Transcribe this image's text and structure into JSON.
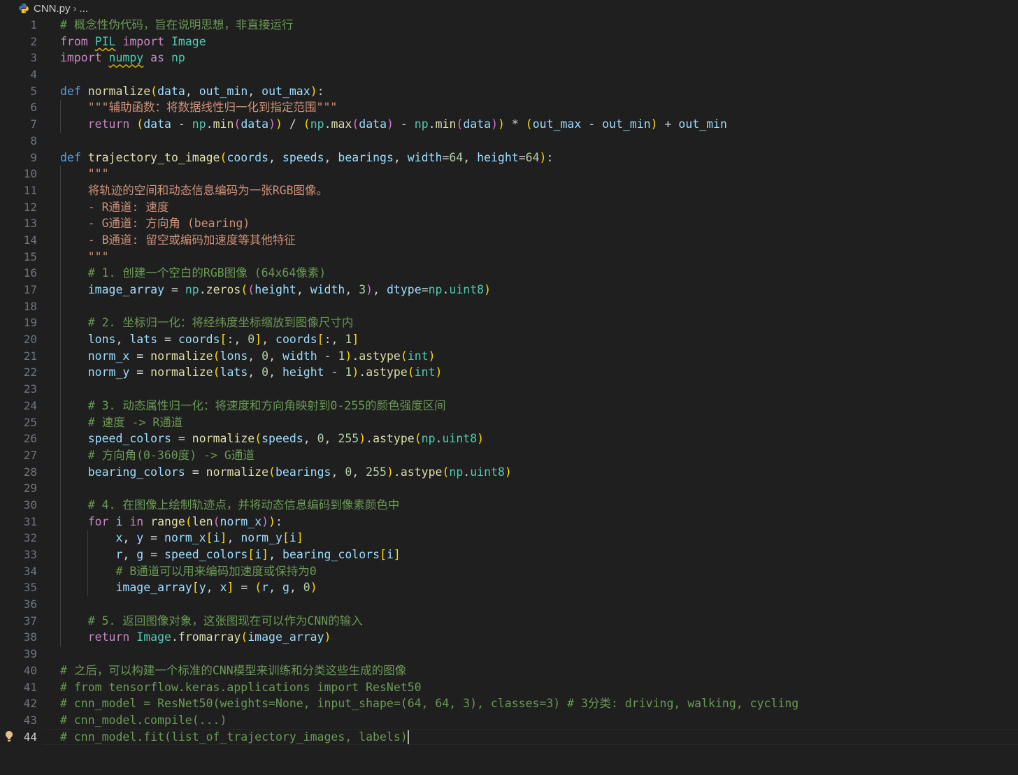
{
  "breadcrumb": {
    "file": "CNN.py",
    "rest": "..."
  },
  "editor": {
    "active_line": 44,
    "lines": [
      [
        [
          "cmt",
          "# 概念性伪代码，旨在说明思想，非直接运行"
        ]
      ],
      [
        [
          "ctl",
          "from"
        ],
        [
          "op",
          " "
        ],
        [
          "cls sq",
          "PIL"
        ],
        [
          "op",
          " "
        ],
        [
          "ctl",
          "import"
        ],
        [
          "op",
          " "
        ],
        [
          "cls",
          "Image"
        ]
      ],
      [
        [
          "ctl",
          "import"
        ],
        [
          "op",
          " "
        ],
        [
          "cls sq",
          "numpy"
        ],
        [
          "op",
          " "
        ],
        [
          "ctl",
          "as"
        ],
        [
          "op",
          " "
        ],
        [
          "cls",
          "np"
        ]
      ],
      [],
      [
        [
          "kw",
          "def"
        ],
        [
          "op",
          " "
        ],
        [
          "fn",
          "normalize"
        ],
        [
          "p1",
          "("
        ],
        [
          "var",
          "data"
        ],
        [
          "op",
          ", "
        ],
        [
          "var",
          "out_min"
        ],
        [
          "op",
          ", "
        ],
        [
          "var",
          "out_max"
        ],
        [
          "p1",
          ")"
        ],
        [
          "op",
          ":"
        ]
      ],
      [
        [
          "op",
          "    "
        ],
        [
          "str",
          "\"\"\"辅助函数：将数据线性归一化到指定范围\"\"\""
        ]
      ],
      [
        [
          "op",
          "    "
        ],
        [
          "ctl",
          "return"
        ],
        [
          "op",
          " "
        ],
        [
          "p1",
          "("
        ],
        [
          "var",
          "data"
        ],
        [
          "op",
          " - "
        ],
        [
          "cls",
          "np"
        ],
        [
          "op",
          "."
        ],
        [
          "fn",
          "min"
        ],
        [
          "p2",
          "("
        ],
        [
          "var",
          "data"
        ],
        [
          "p2",
          ")"
        ],
        [
          "p1",
          ")"
        ],
        [
          "op",
          " / "
        ],
        [
          "p1",
          "("
        ],
        [
          "cls",
          "np"
        ],
        [
          "op",
          "."
        ],
        [
          "fn",
          "max"
        ],
        [
          "p2",
          "("
        ],
        [
          "var",
          "data"
        ],
        [
          "p2",
          ")"
        ],
        [
          "op",
          " - "
        ],
        [
          "cls",
          "np"
        ],
        [
          "op",
          "."
        ],
        [
          "fn",
          "min"
        ],
        [
          "p2",
          "("
        ],
        [
          "var",
          "data"
        ],
        [
          "p2",
          ")"
        ],
        [
          "p1",
          ")"
        ],
        [
          "op",
          " * "
        ],
        [
          "p1",
          "("
        ],
        [
          "var",
          "out_max"
        ],
        [
          "op",
          " - "
        ],
        [
          "var",
          "out_min"
        ],
        [
          "p1",
          ")"
        ],
        [
          "op",
          " + "
        ],
        [
          "var",
          "out_min"
        ]
      ],
      [],
      [
        [
          "kw",
          "def"
        ],
        [
          "op",
          " "
        ],
        [
          "fn",
          "trajectory_to_image"
        ],
        [
          "p1",
          "("
        ],
        [
          "var",
          "coords"
        ],
        [
          "op",
          ", "
        ],
        [
          "var",
          "speeds"
        ],
        [
          "op",
          ", "
        ],
        [
          "var",
          "bearings"
        ],
        [
          "op",
          ", "
        ],
        [
          "var",
          "width"
        ],
        [
          "op",
          "="
        ],
        [
          "num",
          "64"
        ],
        [
          "op",
          ", "
        ],
        [
          "var",
          "height"
        ],
        [
          "op",
          "="
        ],
        [
          "num",
          "64"
        ],
        [
          "p1",
          ")"
        ],
        [
          "op",
          ":"
        ]
      ],
      [
        [
          "op",
          "    "
        ],
        [
          "str",
          "\"\"\""
        ]
      ],
      [
        [
          "op",
          "    "
        ],
        [
          "str",
          "将轨迹的空间和动态信息编码为一张RGB图像。"
        ]
      ],
      [
        [
          "op",
          "    "
        ],
        [
          "str",
          "- R通道: 速度"
        ]
      ],
      [
        [
          "op",
          "    "
        ],
        [
          "str",
          "- G通道: 方向角 (bearing)"
        ]
      ],
      [
        [
          "op",
          "    "
        ],
        [
          "str",
          "- B通道: 留空或编码加速度等其他特征"
        ]
      ],
      [
        [
          "op",
          "    "
        ],
        [
          "str",
          "\"\"\""
        ]
      ],
      [
        [
          "op",
          "    "
        ],
        [
          "cmt",
          "# 1. 创建一个空白的RGB图像 (64x64像素)"
        ]
      ],
      [
        [
          "op",
          "    "
        ],
        [
          "var",
          "image_array"
        ],
        [
          "op",
          " = "
        ],
        [
          "cls",
          "np"
        ],
        [
          "op",
          "."
        ],
        [
          "fn",
          "zeros"
        ],
        [
          "p1",
          "("
        ],
        [
          "p2",
          "("
        ],
        [
          "var",
          "height"
        ],
        [
          "op",
          ", "
        ],
        [
          "var",
          "width"
        ],
        [
          "op",
          ", "
        ],
        [
          "num",
          "3"
        ],
        [
          "p2",
          ")"
        ],
        [
          "op",
          ", "
        ],
        [
          "var",
          "dtype"
        ],
        [
          "op",
          "="
        ],
        [
          "cls",
          "np"
        ],
        [
          "op",
          "."
        ],
        [
          "cls",
          "uint8"
        ],
        [
          "p1",
          ")"
        ]
      ],
      [],
      [
        [
          "op",
          "    "
        ],
        [
          "cmt",
          "# 2. 坐标归一化：将经纬度坐标缩放到图像尺寸内"
        ]
      ],
      [
        [
          "op",
          "    "
        ],
        [
          "var",
          "lons"
        ],
        [
          "op",
          ", "
        ],
        [
          "var",
          "lats"
        ],
        [
          "op",
          " = "
        ],
        [
          "var",
          "coords"
        ],
        [
          "p1",
          "["
        ],
        [
          "op",
          ":, "
        ],
        [
          "num",
          "0"
        ],
        [
          "p1",
          "]"
        ],
        [
          "op",
          ", "
        ],
        [
          "var",
          "coords"
        ],
        [
          "p1",
          "["
        ],
        [
          "op",
          ":, "
        ],
        [
          "num",
          "1"
        ],
        [
          "p1",
          "]"
        ]
      ],
      [
        [
          "op",
          "    "
        ],
        [
          "var",
          "norm_x"
        ],
        [
          "op",
          " = "
        ],
        [
          "fn",
          "normalize"
        ],
        [
          "p1",
          "("
        ],
        [
          "var",
          "lons"
        ],
        [
          "op",
          ", "
        ],
        [
          "num",
          "0"
        ],
        [
          "op",
          ", "
        ],
        [
          "var",
          "width"
        ],
        [
          "op",
          " - "
        ],
        [
          "num",
          "1"
        ],
        [
          "p1",
          ")"
        ],
        [
          "op",
          "."
        ],
        [
          "fn",
          "astype"
        ],
        [
          "p1",
          "("
        ],
        [
          "cls",
          "int"
        ],
        [
          "p1",
          ")"
        ]
      ],
      [
        [
          "op",
          "    "
        ],
        [
          "var",
          "norm_y"
        ],
        [
          "op",
          " = "
        ],
        [
          "fn",
          "normalize"
        ],
        [
          "p1",
          "("
        ],
        [
          "var",
          "lats"
        ],
        [
          "op",
          ", "
        ],
        [
          "num",
          "0"
        ],
        [
          "op",
          ", "
        ],
        [
          "var",
          "height"
        ],
        [
          "op",
          " - "
        ],
        [
          "num",
          "1"
        ],
        [
          "p1",
          ")"
        ],
        [
          "op",
          "."
        ],
        [
          "fn",
          "astype"
        ],
        [
          "p1",
          "("
        ],
        [
          "cls",
          "int"
        ],
        [
          "p1",
          ")"
        ]
      ],
      [],
      [
        [
          "op",
          "    "
        ],
        [
          "cmt",
          "# 3. 动态属性归一化：将速度和方向角映射到0-255的颜色强度区间"
        ]
      ],
      [
        [
          "op",
          "    "
        ],
        [
          "cmt",
          "# 速度 -> R通道"
        ]
      ],
      [
        [
          "op",
          "    "
        ],
        [
          "var",
          "speed_colors"
        ],
        [
          "op",
          " = "
        ],
        [
          "fn",
          "normalize"
        ],
        [
          "p1",
          "("
        ],
        [
          "var",
          "speeds"
        ],
        [
          "op",
          ", "
        ],
        [
          "num",
          "0"
        ],
        [
          "op",
          ", "
        ],
        [
          "num",
          "255"
        ],
        [
          "p1",
          ")"
        ],
        [
          "op",
          "."
        ],
        [
          "fn",
          "astype"
        ],
        [
          "p1",
          "("
        ],
        [
          "cls",
          "np"
        ],
        [
          "op",
          "."
        ],
        [
          "cls",
          "uint8"
        ],
        [
          "p1",
          ")"
        ]
      ],
      [
        [
          "op",
          "    "
        ],
        [
          "cmt",
          "# 方向角(0-360度) -> G通道"
        ]
      ],
      [
        [
          "op",
          "    "
        ],
        [
          "var",
          "bearing_colors"
        ],
        [
          "op",
          " = "
        ],
        [
          "fn",
          "normalize"
        ],
        [
          "p1",
          "("
        ],
        [
          "var",
          "bearings"
        ],
        [
          "op",
          ", "
        ],
        [
          "num",
          "0"
        ],
        [
          "op",
          ", "
        ],
        [
          "num",
          "255"
        ],
        [
          "p1",
          ")"
        ],
        [
          "op",
          "."
        ],
        [
          "fn",
          "astype"
        ],
        [
          "p1",
          "("
        ],
        [
          "cls",
          "np"
        ],
        [
          "op",
          "."
        ],
        [
          "cls",
          "uint8"
        ],
        [
          "p1",
          ")"
        ]
      ],
      [],
      [
        [
          "op",
          "    "
        ],
        [
          "cmt",
          "# 4. 在图像上绘制轨迹点，并将动态信息编码到像素颜色中"
        ]
      ],
      [
        [
          "op",
          "    "
        ],
        [
          "ctl",
          "for"
        ],
        [
          "op",
          " "
        ],
        [
          "var",
          "i"
        ],
        [
          "op",
          " "
        ],
        [
          "ctl",
          "in"
        ],
        [
          "op",
          " "
        ],
        [
          "fn",
          "range"
        ],
        [
          "p1",
          "("
        ],
        [
          "fn",
          "len"
        ],
        [
          "p2",
          "("
        ],
        [
          "var",
          "norm_x"
        ],
        [
          "p2",
          ")"
        ],
        [
          "p1",
          ")"
        ],
        [
          "op",
          ":"
        ]
      ],
      [
        [
          "op",
          "        "
        ],
        [
          "var",
          "x"
        ],
        [
          "op",
          ", "
        ],
        [
          "var",
          "y"
        ],
        [
          "op",
          " = "
        ],
        [
          "var",
          "norm_x"
        ],
        [
          "p1",
          "["
        ],
        [
          "var",
          "i"
        ],
        [
          "p1",
          "]"
        ],
        [
          "op",
          ", "
        ],
        [
          "var",
          "norm_y"
        ],
        [
          "p1",
          "["
        ],
        [
          "var",
          "i"
        ],
        [
          "p1",
          "]"
        ]
      ],
      [
        [
          "op",
          "        "
        ],
        [
          "var",
          "r"
        ],
        [
          "op",
          ", "
        ],
        [
          "var",
          "g"
        ],
        [
          "op",
          " = "
        ],
        [
          "var",
          "speed_colors"
        ],
        [
          "p1",
          "["
        ],
        [
          "var",
          "i"
        ],
        [
          "p1",
          "]"
        ],
        [
          "op",
          ", "
        ],
        [
          "var",
          "bearing_colors"
        ],
        [
          "p1",
          "["
        ],
        [
          "var",
          "i"
        ],
        [
          "p1",
          "]"
        ]
      ],
      [
        [
          "op",
          "        "
        ],
        [
          "cmt",
          "# B通道可以用来编码加速度或保持为0"
        ]
      ],
      [
        [
          "op",
          "        "
        ],
        [
          "var",
          "image_array"
        ],
        [
          "p1",
          "["
        ],
        [
          "var",
          "y"
        ],
        [
          "op",
          ", "
        ],
        [
          "var",
          "x"
        ],
        [
          "p1",
          "]"
        ],
        [
          "op",
          " = "
        ],
        [
          "p1",
          "("
        ],
        [
          "var",
          "r"
        ],
        [
          "op",
          ", "
        ],
        [
          "var",
          "g"
        ],
        [
          "op",
          ", "
        ],
        [
          "num",
          "0"
        ],
        [
          "p1",
          ")"
        ]
      ],
      [],
      [
        [
          "op",
          "    "
        ],
        [
          "cmt",
          "# 5. 返回图像对象，这张图现在可以作为CNN的输入"
        ]
      ],
      [
        [
          "op",
          "    "
        ],
        [
          "ctl",
          "return"
        ],
        [
          "op",
          " "
        ],
        [
          "cls",
          "Image"
        ],
        [
          "op",
          "."
        ],
        [
          "fn",
          "fromarray"
        ],
        [
          "p1",
          "("
        ],
        [
          "var",
          "image_array"
        ],
        [
          "p1",
          ")"
        ]
      ],
      [],
      [
        [
          "cmt",
          "# 之后，可以构建一个标准的CNN模型来训练和分类这些生成的图像"
        ]
      ],
      [
        [
          "cmt",
          "# from tensorflow.keras.applications import ResNet50"
        ]
      ],
      [
        [
          "cmt",
          "# cnn_model = ResNet50(weights=None, input_shape=(64, 64, 3), classes=3) # 3分类: driving, walking, cycling"
        ]
      ],
      [
        [
          "cmt",
          "# cnn_model.compile(...)"
        ]
      ],
      [
        [
          "cmt",
          "# cnn_model.fit(list_of_trajectory_images, labels)"
        ]
      ]
    ]
  }
}
